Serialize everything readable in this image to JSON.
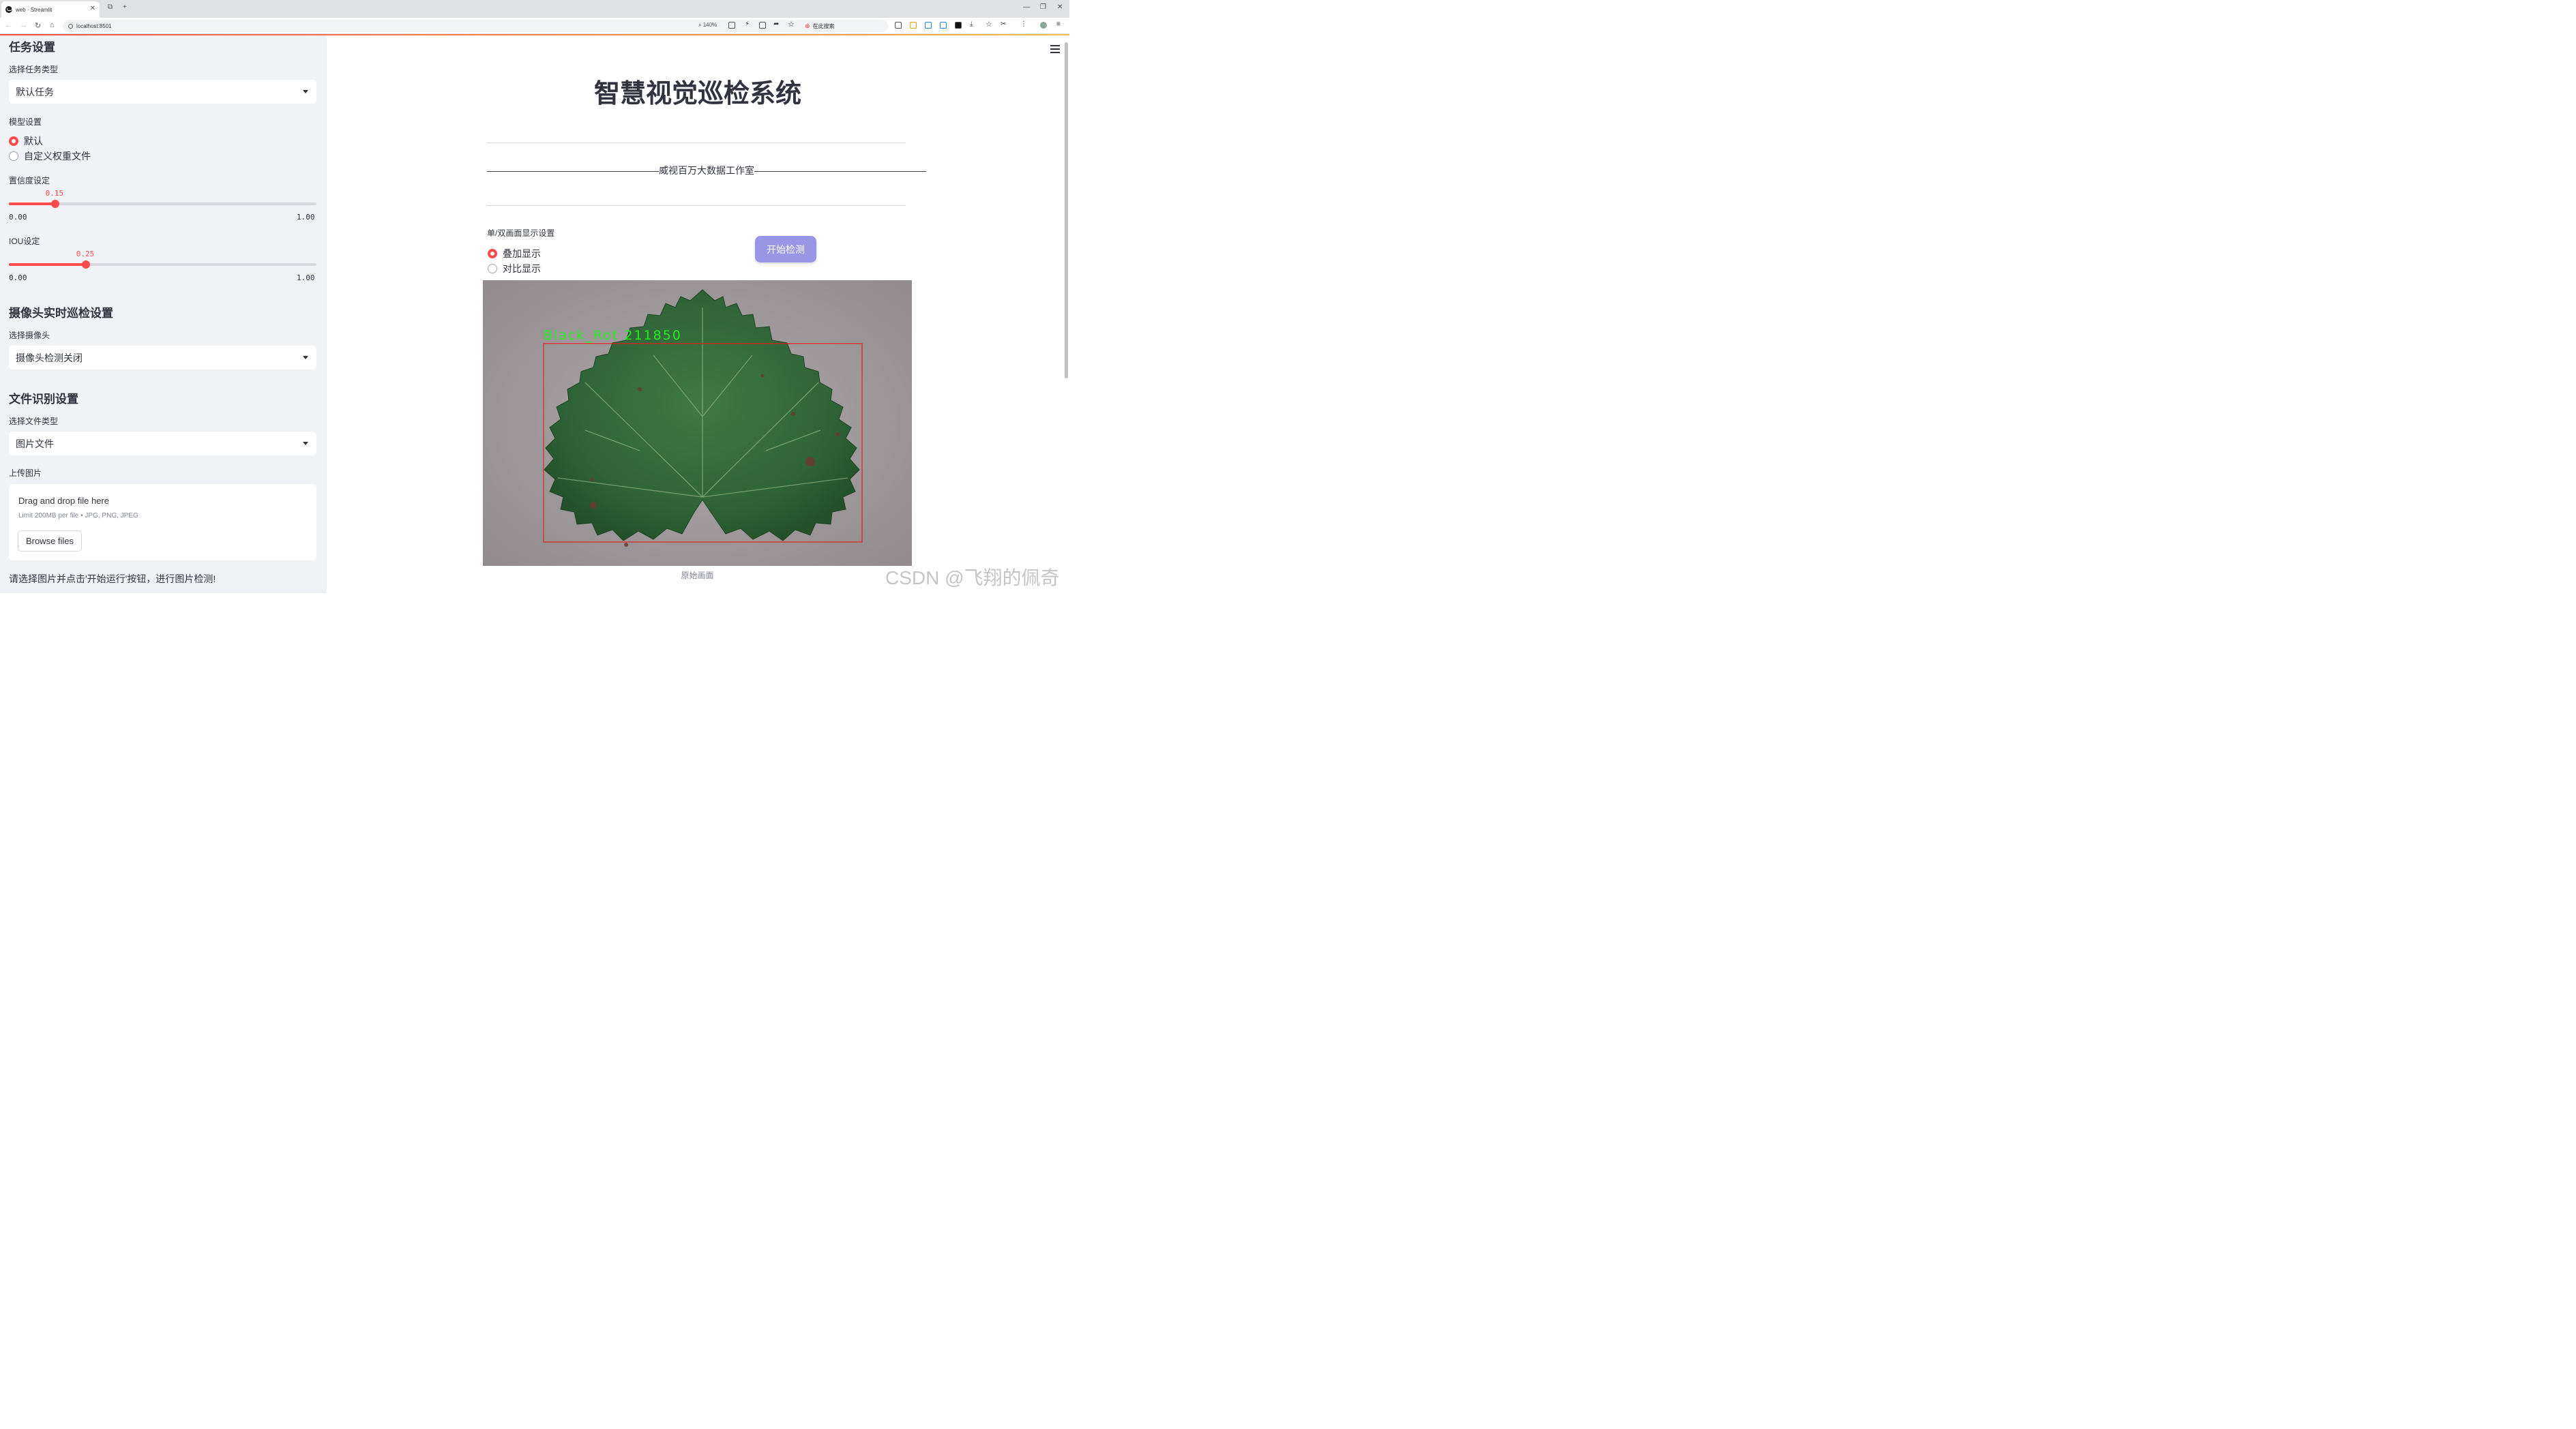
{
  "browser": {
    "tab_title": "web · Streamlit",
    "url": "localhost:8501",
    "zoom": "140%",
    "search_label": "在此搜索"
  },
  "sidebar": {
    "task_section_title": "任务设置",
    "task_type_label": "选择任务类型",
    "task_type_value": "默认任务",
    "model_label": "模型设置",
    "model_options": [
      "默认",
      "自定义权重文件"
    ],
    "model_selected": "默认",
    "conf_label": "置信度设定",
    "conf_value": "0.15",
    "conf_fraction": 0.15,
    "conf_min": "0.00",
    "conf_max": "1.00",
    "iou_label": "IOU设定",
    "iou_value": "0.25",
    "iou_fraction": 0.25,
    "iou_min": "0.00",
    "iou_max": "1.00",
    "camera_section_title": "摄像头实时巡检设置",
    "camera_label": "选择摄像头",
    "camera_value": "摄像头检测关闭",
    "file_section_title": "文件识别设置",
    "file_type_label": "选择文件类型",
    "file_type_value": "图片文件",
    "upload_label": "上传图片",
    "upload_title": "Drag and drop file here",
    "upload_limit": "Limit 200MB per file • JPG, PNG, JPEG",
    "browse_button": "Browse files",
    "footer_hint": "请选择图片并点击'开始运行'按钮，进行图片检测!"
  },
  "main": {
    "title": "智慧视觉巡检系统",
    "studio_line": "——————————————————威视百万大数据工作室——————————————————",
    "display_mode_label": "单/双画面显示设置",
    "display_options": [
      "叠加显示",
      "对比显示"
    ],
    "display_selected": "叠加显示",
    "start_button": "开始检测",
    "detection_label": "Black_Rot  211850",
    "image_caption": "原始画面",
    "watermark": "CSDN @飞翔的佩奇"
  },
  "colors": {
    "accent": "#ff4b4b",
    "sidebar_bg": "#f0f2f6",
    "start_button": "#9b95e8",
    "detection_box": "#e02020",
    "detection_text": "#22ee22"
  }
}
